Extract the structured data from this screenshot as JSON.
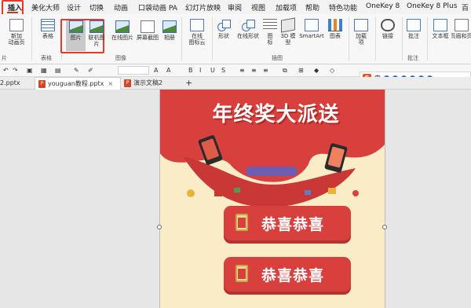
{
  "ribbon_tabs": [
    {
      "label": "插入",
      "active": true
    },
    {
      "label": "美化大师"
    },
    {
      "label": "设计"
    },
    {
      "label": "切换"
    },
    {
      "label": "动画"
    },
    {
      "label": "口袋动画 PA"
    },
    {
      "label": "幻灯片放映"
    },
    {
      "label": "审阅"
    },
    {
      "label": "视图"
    },
    {
      "label": "加载项"
    },
    {
      "label": "帮助"
    },
    {
      "label": "特色功能"
    },
    {
      "label": "OneKey 8"
    },
    {
      "label": "OneKey 8 Plus"
    },
    {
      "label": "百"
    }
  ],
  "ribbon": {
    "new_animation_page": "新加\n动画页",
    "table": "表格",
    "picture": "图片",
    "online_picture": "联机图片",
    "online_pictures2": "在线图片",
    "screenshot": "屏幕截图",
    "album": "相册",
    "online_icon_cloud": "在线\n图标云",
    "shapes": "形状",
    "online_shapes": "在线形状",
    "icons": "图\n标",
    "model3d": "3D 模\n型",
    "smartart": "SmartArt",
    "chart": "图表",
    "addins": "加载\n项",
    "link": "链接",
    "comment": "批注",
    "textbox": "文本框",
    "header_footer": "页眉和页",
    "groups": {
      "slides": "片",
      "tables": "表格",
      "images": "图像",
      "illustrations": "插图",
      "comments": "批注"
    }
  },
  "doc_tabs": [
    {
      "label": "2.pptx"
    },
    {
      "label": "youguan教程.pptx",
      "active": true
    },
    {
      "label": "演示文稿2"
    }
  ],
  "ime": {
    "logo": "S",
    "lang": "中"
  },
  "slide": {
    "headline": "年终奖大派送",
    "button1": "恭喜恭喜",
    "button2": "恭喜恭喜"
  },
  "colors": {
    "accent": "#e23b2e",
    "slide_bg": "#faecc6",
    "red": "#d8403e"
  }
}
